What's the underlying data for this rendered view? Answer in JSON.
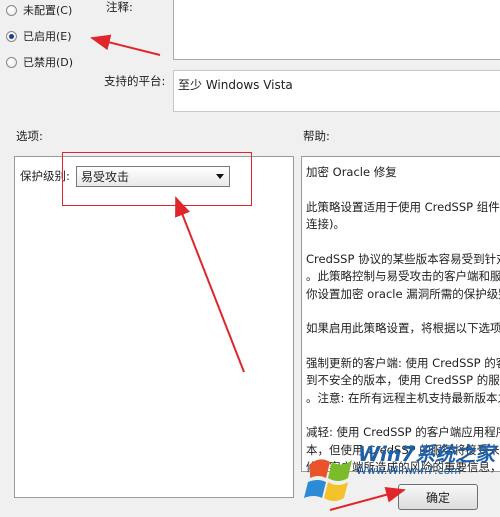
{
  "state_radios": [
    {
      "label": "未配置(C)",
      "checked": false
    },
    {
      "label": "已启用(E)",
      "checked": true
    },
    {
      "label": "已禁用(D)",
      "checked": false
    }
  ],
  "comment_label": "注释:",
  "platform_label": "支持的平台:",
  "platform_value": "至少 Windows Vista",
  "options_header": "选项:",
  "help_header": "帮助:",
  "protection_label": "保护级别:",
  "protection_value": "易受攻击",
  "help_lines": [
    "加密 Oracle 修复",
    "此策略设置适用于使用 CredSSP 组件的",
    "连接)。",
    "CredSSP 协议的某些版本容易受到针对",
    "。此策略控制与易受攻击的客户端和服务",
    "你设置加密 oracle 漏洞所需的保护级别",
    "如果启用此策略设置，将根据以下选项",
    "强制更新的客户端: 使用 CredSSP 的客",
    "到不安全的版本，使用 CredSSP 的服务",
    "。注意: 在所有远程主机支持最新版本之",
    "减轻: 使用 CredSSP 的客户端应用程序",
    "本，但使用 CredSSP 的服务将接受未修",
    "修补客户端所造成的风险的重要信息，"
  ],
  "ok_button_label": "确定",
  "watermark": {
    "brand": "Win7系统之家",
    "url": "Www.Winwin7.com"
  },
  "colors": {
    "annotation_red": "#e0262a",
    "background": "#f0f0f0"
  }
}
